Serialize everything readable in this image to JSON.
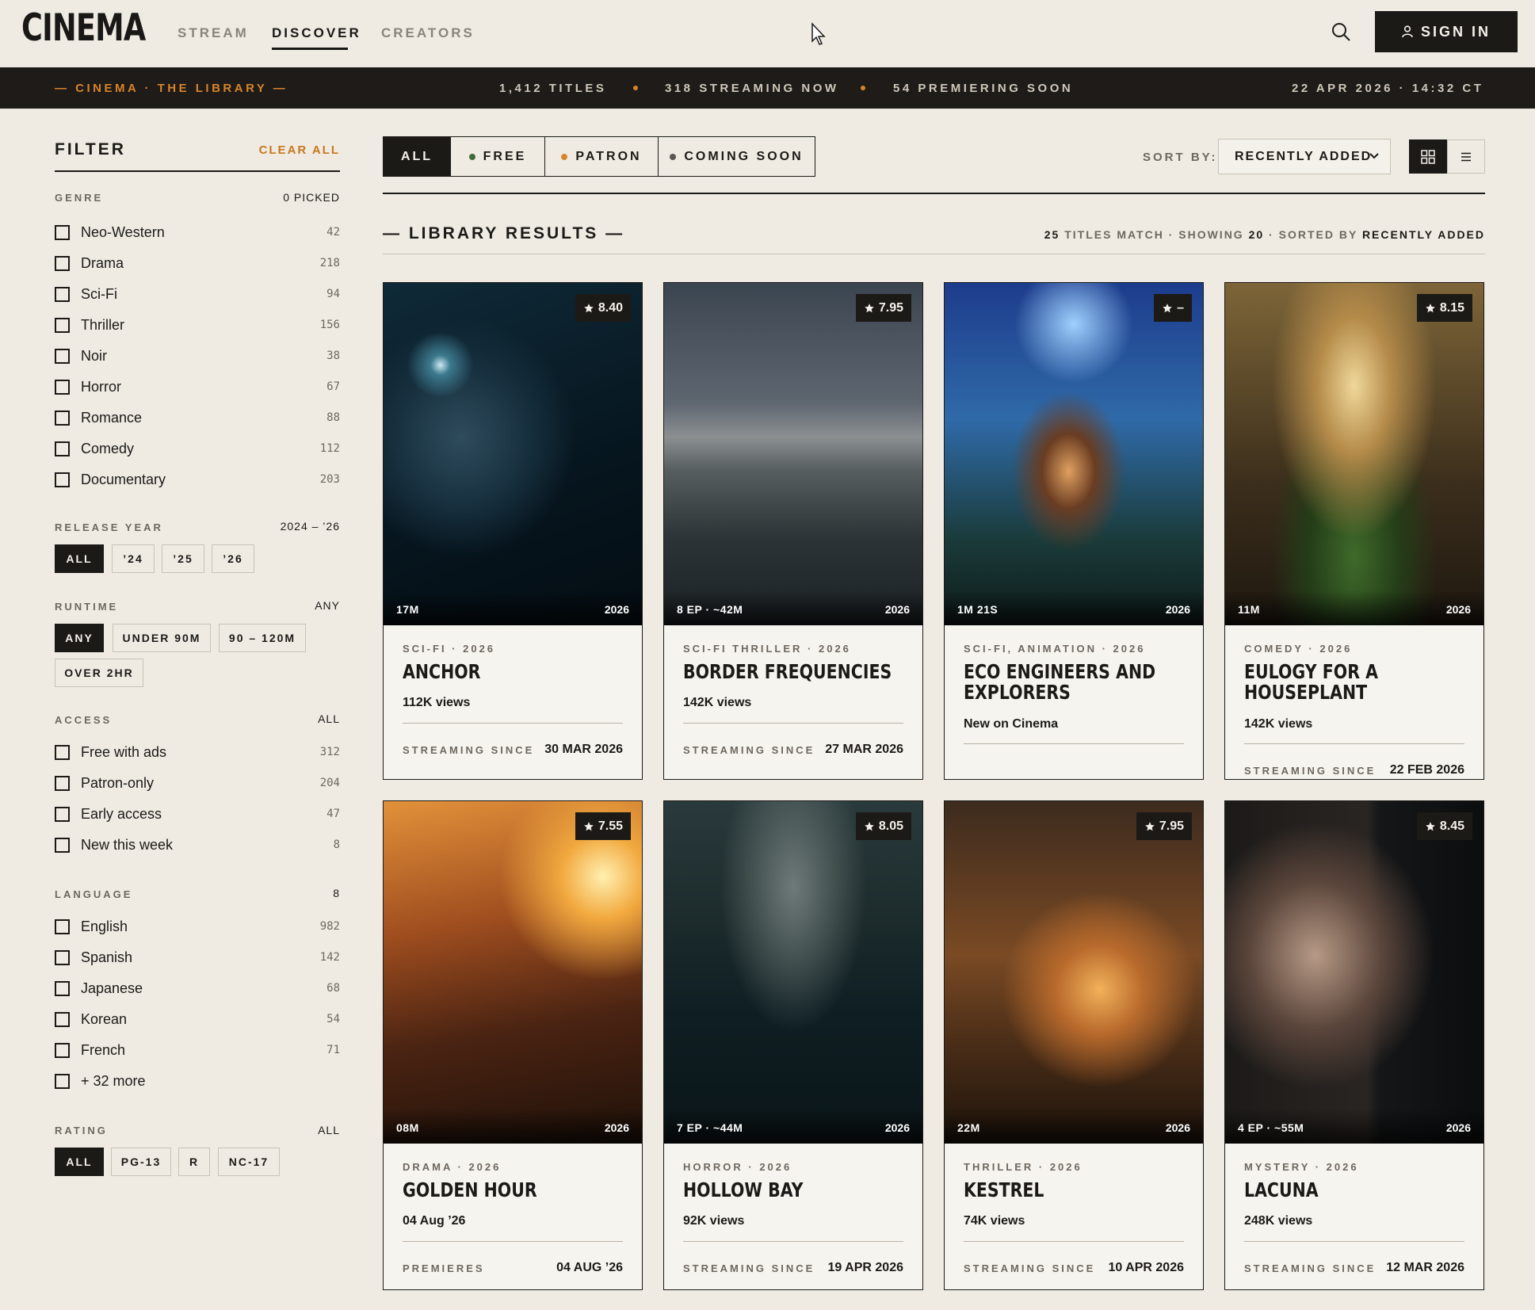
{
  "nav": {
    "logo": "CINEMA",
    "links": [
      "STREAM",
      "DISCOVER",
      "CREATORS"
    ],
    "sign_in": "SIGN IN"
  },
  "ticker": {
    "brand": "— CINEMA · THE LIBRARY —",
    "titles": "1,412 TITLES",
    "streaming": "318 STREAMING NOW",
    "premiering": "54 PREMIERING SOON",
    "datetime": "22 APR 2026 · 14:32 CT"
  },
  "filter": {
    "title": "FILTER",
    "clear": "CLEAR ALL",
    "genre": {
      "label": "GENRE",
      "value": "0 PICKED",
      "items": [
        {
          "label": "Neo-Western",
          "count": "42"
        },
        {
          "label": "Drama",
          "count": "218"
        },
        {
          "label": "Sci-Fi",
          "count": "94"
        },
        {
          "label": "Thriller",
          "count": "156"
        },
        {
          "label": "Noir",
          "count": "38"
        },
        {
          "label": "Horror",
          "count": "67"
        },
        {
          "label": "Romance",
          "count": "88"
        },
        {
          "label": "Comedy",
          "count": "112"
        },
        {
          "label": "Documentary",
          "count": "203"
        }
      ]
    },
    "release": {
      "label": "RELEASE YEAR",
      "value": "2024 – ’26",
      "chips": [
        "ALL",
        "’24",
        "’25",
        "’26"
      ]
    },
    "runtime": {
      "label": "RUNTIME",
      "value": "ANY",
      "chips": [
        "ANY",
        "UNDER 90M",
        "90 – 120M",
        "OVER 2HR"
      ]
    },
    "access": {
      "label": "ACCESS",
      "value": "ALL",
      "items": [
        {
          "label": "Free with ads",
          "count": "312"
        },
        {
          "label": "Patron-only",
          "count": "204"
        },
        {
          "label": "Early access",
          "count": "47"
        },
        {
          "label": "New this week",
          "count": "8"
        }
      ]
    },
    "language": {
      "label": "LANGUAGE",
      "value": "8",
      "items": [
        {
          "label": "English",
          "count": "982"
        },
        {
          "label": "Spanish",
          "count": "142"
        },
        {
          "label": "Japanese",
          "count": "68"
        },
        {
          "label": "Korean",
          "count": "54"
        },
        {
          "label": "French",
          "count": "71"
        },
        {
          "label": "+ 32 more",
          "count": ""
        }
      ]
    },
    "rating": {
      "label": "RATING",
      "value": "ALL",
      "chips": [
        "ALL",
        "PG-13",
        "R",
        "NC-17"
      ]
    }
  },
  "toolbar": {
    "tabs": [
      "ALL",
      "FREE",
      "PATRON",
      "COMING SOON"
    ],
    "tab_dot_colors": [
      "",
      "#3f6b3a",
      "#d8842a",
      "#5a5650"
    ],
    "sort_label": "SORT BY:",
    "sort_value": "RECENTLY ADDED"
  },
  "results": {
    "title": "— LIBRARY RESULTS —",
    "meta_a": "25",
    "meta_b": " TITLES MATCH · SHOWING ",
    "meta_c": "20",
    "meta_d": " · SORTED BY ",
    "meta_e": "RECENTLY ADDED"
  },
  "cards": [
    {
      "rating": "8.40",
      "runtime": "17M",
      "year": "2026",
      "genre": "SCI-FI · 2026",
      "title": "ANCHOR",
      "sub": "112K views",
      "flabel": "STREAMING SINCE",
      "fval": "30 MAR 2026"
    },
    {
      "rating": "7.95",
      "runtime": "8 EP · ~42M",
      "year": "2026",
      "genre": "SCI-FI THRILLER · 2026",
      "title": "BORDER FREQUENCIES",
      "sub": "142K views",
      "flabel": "STREAMING SINCE",
      "fval": "27 MAR 2026"
    },
    {
      "rating": "–",
      "runtime": "1M 21S",
      "year": "2026",
      "genre": "SCI-FI, ANIMATION · 2026",
      "title": "ECO ENGINEERS AND EXPLORERS",
      "sub": "New on Cinema",
      "flabel": "",
      "fval": ""
    },
    {
      "rating": "8.15",
      "runtime": "11M",
      "year": "2026",
      "genre": "COMEDY · 2026",
      "title": "EULOGY FOR A HOUSEPLANT",
      "sub": "142K views",
      "flabel": "STREAMING SINCE",
      "fval": "22 FEB 2026"
    },
    {
      "rating": "7.55",
      "runtime": "08M",
      "year": "2026",
      "genre": "DRAMA · 2026",
      "title": "GOLDEN HOUR",
      "sub": "04 Aug ’26",
      "flabel": "PREMIERES",
      "fval": "04 AUG ’26"
    },
    {
      "rating": "8.05",
      "runtime": "7 EP · ~44M",
      "year": "2026",
      "genre": "HORROR · 2026",
      "title": "HOLLOW BAY",
      "sub": "92K views",
      "flabel": "STREAMING SINCE",
      "fval": "19 APR 2026"
    },
    {
      "rating": "7.95",
      "runtime": "22M",
      "year": "2026",
      "genre": "THRILLER · 2026",
      "title": "KESTREL",
      "sub": "74K views",
      "flabel": "STREAMING SINCE",
      "fval": "10 APR 2026"
    },
    {
      "rating": "8.45",
      "runtime": "4 EP · ~55M",
      "year": "2026",
      "genre": "MYSTERY · 2026",
      "title": "LACUNA",
      "sub": "248K views",
      "flabel": "STREAMING SINCE",
      "fval": "12 MAR 2026"
    }
  ]
}
